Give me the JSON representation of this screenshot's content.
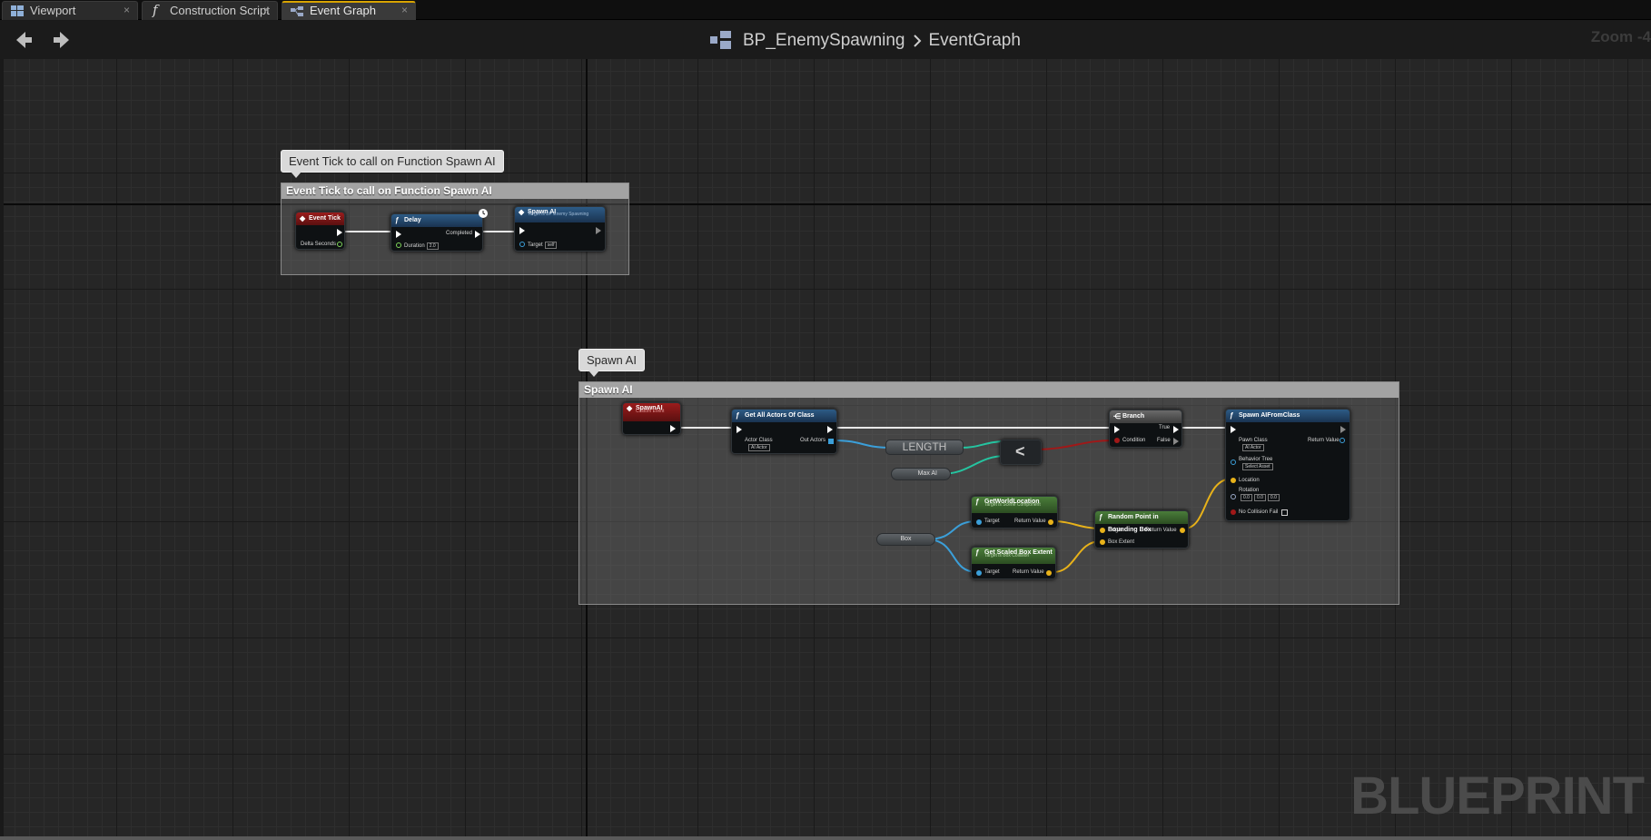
{
  "tabs": [
    {
      "label": "Viewport",
      "icon": "viewport-icon",
      "active": false
    },
    {
      "label": "Construction Script",
      "icon": "function-icon",
      "active": false
    },
    {
      "label": "Event Graph",
      "icon": "event-graph-icon",
      "active": true
    }
  ],
  "header": {
    "blueprint": "BP_EnemySpawning",
    "graph": "EventGraph",
    "zoom": "Zoom -4"
  },
  "comments": {
    "tick": {
      "bubble": "Event Tick to call on Function Spawn AI",
      "title": "Event Tick to call on Function Spawn AI"
    },
    "spawn": {
      "bubble": "Spawn   AI",
      "title": "Spawn   AI"
    }
  },
  "nodes": {
    "event_tick": {
      "title": "Event Tick",
      "pin_delta": "Delta Seconds"
    },
    "delay": {
      "title": "Delay",
      "pin_completed": "Completed",
      "pin_duration": "Duration",
      "duration_value": "2.0"
    },
    "spawn_ai_call": {
      "title": "Spawn AI",
      "subtitle": "Target is BP Enemy Spawning",
      "pin_target": "Target",
      "target_value": "self"
    },
    "custom_event": {
      "title": "SpawnAI",
      "subtitle": "Custom Event"
    },
    "get_all_actors": {
      "title": "Get All Actors Of Class",
      "pin_actor_class": "Actor Class",
      "actor_class_value": "AI Actor",
      "pin_out_actors": "Out Actors"
    },
    "length": {
      "title": "LENGTH"
    },
    "less": {
      "title": "<"
    },
    "max_ai": {
      "label": "Max AI"
    },
    "branch": {
      "title": "Branch",
      "pin_condition": "Condition",
      "pin_true": "True",
      "pin_false": "False"
    },
    "spawn_from_class": {
      "title": "Spawn AIFromClass",
      "pin_pawn_class": "Pawn Class",
      "pawn_class_value": "AI Actor",
      "pin_return": "Return Value",
      "pin_behavior": "Behavior Tree",
      "behavior_value": "Select Asset",
      "pin_location": "Location",
      "pin_rotation": "Rotation",
      "rotation_values": [
        "0.0",
        "0.0",
        "0.0"
      ],
      "pin_no_collision": "No Collision Fail"
    },
    "get_world_location": {
      "title": "GetWorldLocation",
      "subtitle": "Target is Scene Component",
      "pin_target": "Target",
      "pin_return": "Return Value"
    },
    "get_scaled_box": {
      "title": "Get Scaled Box Extent",
      "subtitle": "Target is Box Collision",
      "pin_target": "Target",
      "pin_return": "Return Value"
    },
    "random_point": {
      "title": "Random Point in Bounding Box",
      "pin_origin": "Origin",
      "pin_extent": "Box Extent",
      "pin_return": "Return Value"
    },
    "box_var": {
      "label": "Box"
    }
  },
  "watermark": "BLUEPRINT"
}
